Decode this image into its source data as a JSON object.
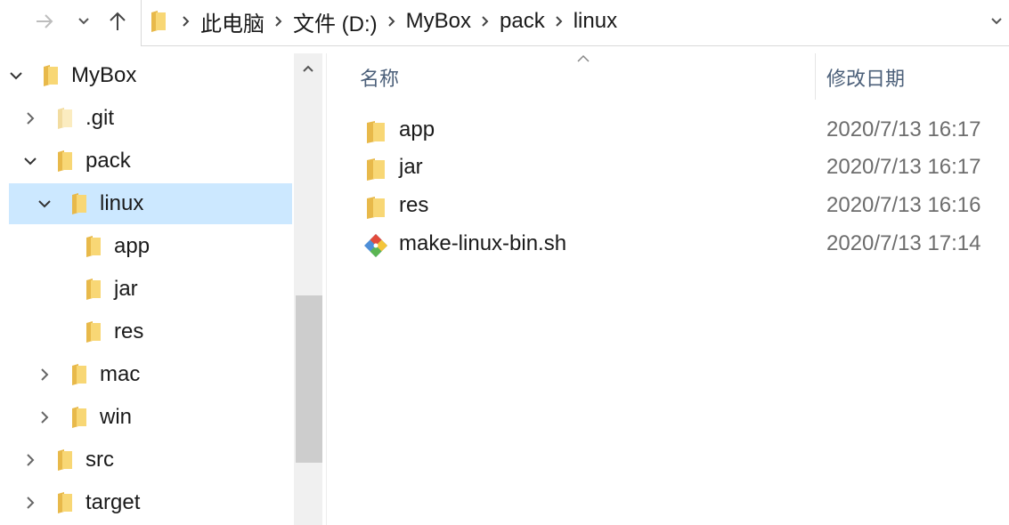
{
  "address_bar": {
    "crumbs": [
      "此电脑",
      "文件 (D:)",
      "MyBox",
      "pack",
      "linux"
    ]
  },
  "tree": {
    "items": [
      {
        "label": "MyBox",
        "expanded": true
      },
      {
        "label": ".git",
        "expanded": false
      },
      {
        "label": "pack",
        "expanded": true
      },
      {
        "label": "linux",
        "expanded": true,
        "selected": true
      },
      {
        "label": "app"
      },
      {
        "label": "jar"
      },
      {
        "label": "res"
      },
      {
        "label": "mac",
        "expanded": false
      },
      {
        "label": "win",
        "expanded": false
      },
      {
        "label": "src",
        "expanded": false
      },
      {
        "label": "target",
        "expanded": false
      }
    ]
  },
  "list": {
    "columns": {
      "name": "名称",
      "modified": "修改日期"
    },
    "files": [
      {
        "name": "app",
        "modified": "2020/7/13 16:17",
        "icon": "folder-icon"
      },
      {
        "name": "jar",
        "modified": "2020/7/13 16:17",
        "icon": "folder-icon"
      },
      {
        "name": "res",
        "modified": "2020/7/13 16:16",
        "icon": "folder-icon"
      },
      {
        "name": "make-linux-bin.sh",
        "modified": "2020/7/13 17:14",
        "icon": "git-file-icon"
      }
    ]
  },
  "colors": {
    "selection": "#cce8ff",
    "folder": "#f8d775",
    "header_text": "#4c607a",
    "date_text": "#6d6d6d"
  }
}
